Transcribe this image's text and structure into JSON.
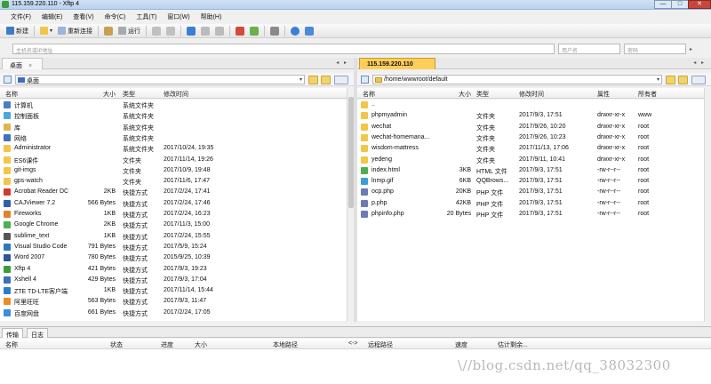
{
  "window": {
    "title": "115.159.220.110 - Xftp 4",
    "minimize": "—",
    "maximize": "□",
    "close": "✕"
  },
  "menu": [
    "文件(F)",
    "编辑(E)",
    "查看(V)",
    "命令(C)",
    "工具(T)",
    "窗口(W)",
    "帮助(H)"
  ],
  "toolbar": {
    "new_label": "新建",
    "reconnect_label": "重新连接",
    "run_label": "运行"
  },
  "address": {
    "host_placeholder": "主机名或IP地址",
    "user_placeholder": "用户名",
    "password_placeholder": "密码"
  },
  "left_pane": {
    "tab": "桌面",
    "path": "桌面",
    "columns": {
      "name": "名称",
      "size": "大小",
      "type": "类型",
      "modified": "修改时间"
    },
    "rows": [
      {
        "name": "计算机",
        "size": "",
        "type": "系统文件夹",
        "date": "",
        "icon": "computer-icon",
        "color": "#4a7cc9"
      },
      {
        "name": "控制面板",
        "size": "",
        "type": "系统文件夹",
        "date": "",
        "icon": "control-panel-icon",
        "color": "#4aa7d9"
      },
      {
        "name": "库",
        "size": "",
        "type": "系统文件夹",
        "date": "",
        "icon": "library-icon",
        "color": "#e1b54a"
      },
      {
        "name": "网络",
        "size": "",
        "type": "系统文件夹",
        "date": "",
        "icon": "network-icon",
        "color": "#3d72c4"
      },
      {
        "name": "Administrator",
        "size": "",
        "type": "系统文件夹",
        "date": "2017/10/24, 19:35",
        "icon": "user-folder-icon",
        "color": "#f2c649"
      },
      {
        "name": "ES6课件",
        "size": "",
        "type": "文件夹",
        "date": "2017/11/14, 19:26",
        "icon": "folder-icon",
        "color": "#f2c649"
      },
      {
        "name": "git-imgs",
        "size": "",
        "type": "文件夹",
        "date": "2017/10/9, 19:48",
        "icon": "folder-icon",
        "color": "#f2c649"
      },
      {
        "name": "gps-watch",
        "size": "",
        "type": "文件夹",
        "date": "2017/11/6, 17:47",
        "icon": "folder-icon",
        "color": "#f2c649"
      },
      {
        "name": "Acrobat Reader DC",
        "size": "2KB",
        "type": "快捷方式",
        "date": "2017/2/24, 17:41",
        "icon": "acrobat-icon",
        "color": "#d33a2c"
      },
      {
        "name": "CAJViewer 7.2",
        "size": "566 Bytes",
        "type": "快捷方式",
        "date": "2017/2/24, 17:46",
        "icon": "cajviewer-icon",
        "color": "#2f5fb0"
      },
      {
        "name": "Fireworks",
        "size": "1KB",
        "type": "快捷方式",
        "date": "2017/2/24, 16:23",
        "icon": "fireworks-icon",
        "color": "#e0842a"
      },
      {
        "name": "Google Chrome",
        "size": "2KB",
        "type": "快捷方式",
        "date": "2017/11/3, 15:00",
        "icon": "chrome-icon",
        "color": "#4caf50"
      },
      {
        "name": "sublime_text",
        "size": "1KB",
        "type": "快捷方式",
        "date": "2017/2/24, 15:55",
        "icon": "sublime-icon",
        "color": "#555555"
      },
      {
        "name": "Visual Studio Code",
        "size": "791 Bytes",
        "type": "快捷方式",
        "date": "2017/5/9, 15:24",
        "icon": "vscode-icon",
        "color": "#2b78c4"
      },
      {
        "name": "Word 2007",
        "size": "780 Bytes",
        "type": "快捷方式",
        "date": "2015/9/25, 10:39",
        "icon": "word-icon",
        "color": "#2b5797"
      },
      {
        "name": "Xftp 4",
        "size": "421 Bytes",
        "type": "快捷方式",
        "date": "2017/9/3, 19:23",
        "icon": "xftp-icon",
        "color": "#3a9d3a"
      },
      {
        "name": "Xshell 4",
        "size": "429 Bytes",
        "type": "快捷方式",
        "date": "2017/9/3, 17:04",
        "icon": "xshell-icon",
        "color": "#3b6fc0"
      },
      {
        "name": "ZTE TD-LTE客户端",
        "size": "1KB",
        "type": "快捷方式",
        "date": "2017/11/14, 15:44",
        "icon": "zte-icon",
        "color": "#2a7fc9"
      },
      {
        "name": "阿里旺旺",
        "size": "563 Bytes",
        "type": "快捷方式",
        "date": "2017/9/3, 11:47",
        "icon": "aliwangwang-icon",
        "color": "#f08a24"
      },
      {
        "name": "百度网盘",
        "size": "661 Bytes",
        "type": "快捷方式",
        "date": "2017/2/24, 17:05",
        "icon": "baidu-netdisk-icon",
        "color": "#3b8de0"
      }
    ]
  },
  "right_pane": {
    "tab": "115.159.220.110",
    "path": "/home/wwwroot/default",
    "columns": {
      "name": "名称",
      "size": "大小",
      "type": "类型",
      "modified": "修改时间",
      "attrs": "属性",
      "owner": "所有者"
    },
    "rows": [
      {
        "name": "..",
        "size": "",
        "type": "",
        "date": "",
        "attrs": "",
        "owner": "",
        "icon": "parent-folder-icon",
        "color": "#f2c649"
      },
      {
        "name": "phpmyadmin",
        "size": "",
        "type": "文件夹",
        "date": "2017/9/3, 17:51",
        "attrs": "drwxr-xr-x",
        "owner": "www",
        "icon": "folder-icon",
        "color": "#f2c649"
      },
      {
        "name": "wechat",
        "size": "",
        "type": "文件夹",
        "date": "2017/9/26, 10:20",
        "attrs": "drwxr-xr-x",
        "owner": "root",
        "icon": "folder-icon",
        "color": "#f2c649"
      },
      {
        "name": "wechat-homemana...",
        "size": "",
        "type": "文件夹",
        "date": "2017/9/26, 10:23",
        "attrs": "drwxr-xr-x",
        "owner": "root",
        "icon": "folder-icon",
        "color": "#f2c649"
      },
      {
        "name": "wisdom-mattress",
        "size": "",
        "type": "文件夹",
        "date": "2017/11/13, 17:06",
        "attrs": "drwxr-xr-x",
        "owner": "root",
        "icon": "folder-icon",
        "color": "#f2c649"
      },
      {
        "name": "yedeng",
        "size": "",
        "type": "文件夹",
        "date": "2017/9/11, 10:41",
        "attrs": "drwxr-xr-x",
        "owner": "root",
        "icon": "folder-icon",
        "color": "#f2c649"
      },
      {
        "name": "index.html",
        "size": "3KB",
        "type": "HTML 文件",
        "date": "2017/9/3, 17:51",
        "attrs": "-rw-r--r--",
        "owner": "root",
        "icon": "chrome-icon",
        "color": "#4caf50"
      },
      {
        "name": "lnmp.gif",
        "size": "6KB",
        "type": "QQBrows...",
        "date": "2017/9/3, 17:51",
        "attrs": "-rw-r--r--",
        "owner": "root",
        "icon": "image-icon",
        "color": "#3a9fd6"
      },
      {
        "name": "ocp.php",
        "size": "20KB",
        "type": "PHP 文件",
        "date": "2017/9/3, 17:51",
        "attrs": "-rw-r--r--",
        "owner": "root",
        "icon": "php-file-icon",
        "color": "#6a7bb5"
      },
      {
        "name": "p.php",
        "size": "42KB",
        "type": "PHP 文件",
        "date": "2017/9/3, 17:51",
        "attrs": "-rw-r--r--",
        "owner": "root",
        "icon": "php-file-icon",
        "color": "#6a7bb5"
      },
      {
        "name": "phpinfo.php",
        "size": "20 Bytes",
        "type": "PHP 文件",
        "date": "2017/9/3, 17:51",
        "attrs": "-rw-r--r--",
        "owner": "root",
        "icon": "php-file-icon",
        "color": "#6a7bb5"
      }
    ]
  },
  "bottom": {
    "tabs": [
      "传输",
      "日志"
    ],
    "columns": {
      "name": "名称",
      "status": "状态",
      "progress": "进度",
      "size": "大小",
      "local": "本地路径",
      "arrow": "<->",
      "remote": "远程路径",
      "speed": "速度",
      "eta": "估计剩余..."
    }
  },
  "watermark": "\\//blog.csdn.net/qq_38032300"
}
